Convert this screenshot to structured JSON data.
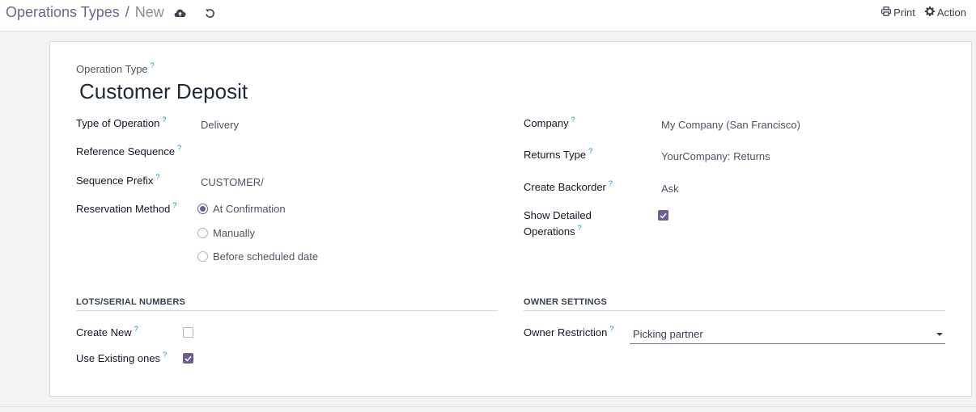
{
  "breadcrumb": {
    "parent": "Operations Types",
    "separator": "/",
    "current": "New"
  },
  "toolbar": {
    "print_label": "Print",
    "action_label": "Action"
  },
  "icons": {
    "save": "cloud-upload-icon",
    "discard": "undo-icon",
    "print": "printer-icon",
    "action": "gear-icon"
  },
  "form": {
    "operation_type_label": "Operation Type",
    "name": "Customer Deposit",
    "help_mark": "?",
    "left": {
      "type_of_operation": {
        "label": "Type of Operation",
        "value": "Delivery"
      },
      "reference_sequence": {
        "label": "Reference Sequence",
        "value": ""
      },
      "sequence_prefix": {
        "label": "Sequence Prefix",
        "value": "CUSTOMER/"
      },
      "reservation_method": {
        "label": "Reservation Method",
        "options": [
          "At Confirmation",
          "Manually",
          "Before scheduled date"
        ],
        "selected": "At Confirmation"
      }
    },
    "right": {
      "company": {
        "label": "Company",
        "value": "My Company (San Francisco)"
      },
      "returns_type": {
        "label": "Returns Type",
        "value": "YourCompany: Returns"
      },
      "create_backorder": {
        "label": "Create Backorder",
        "value": "Ask"
      },
      "show_detailed_operations": {
        "label_line1": "Show Detailed",
        "label_line2": "Operations",
        "checked": true
      }
    },
    "lots": {
      "title": "LOTS/SERIAL NUMBERS",
      "create_new": {
        "label": "Create New",
        "checked": false
      },
      "use_existing": {
        "label": "Use Existing ones",
        "checked": true
      }
    },
    "owner": {
      "title": "OWNER SETTINGS",
      "owner_restriction": {
        "label": "Owner Restriction",
        "value": "Picking partner"
      }
    }
  },
  "colors": {
    "accent": "#6c5d8f",
    "breadcrumb": "#6c6697",
    "help": "#0a8fb5"
  }
}
